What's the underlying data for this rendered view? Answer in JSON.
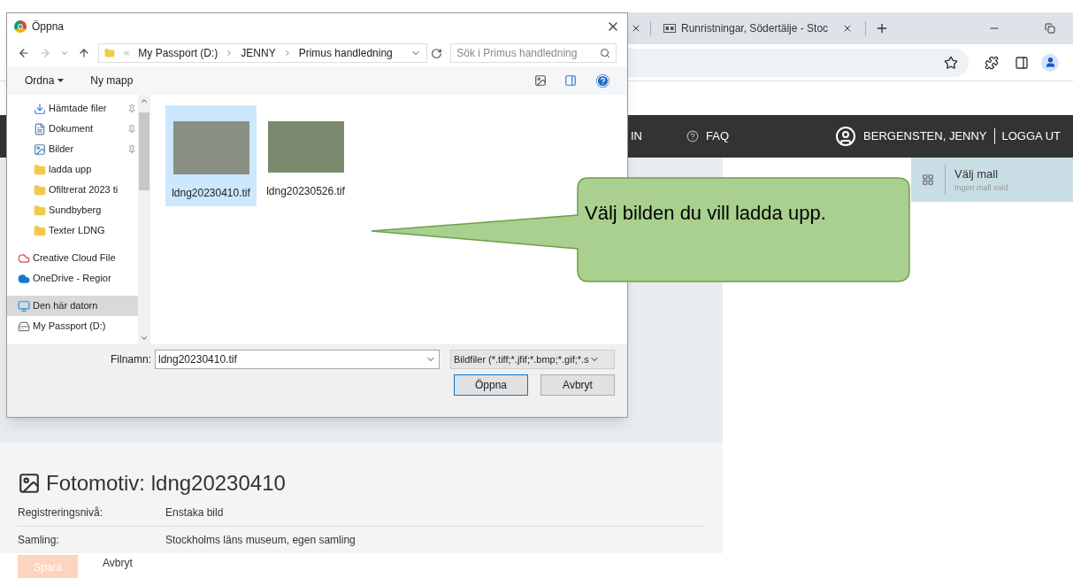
{
  "browser": {
    "tabs": [
      {
        "title": "Runristningar, Södertälje - Stoc",
        "selected": false
      }
    ]
  },
  "nav": {
    "items": [
      {
        "label": "IN"
      },
      {
        "label": "FAQ"
      }
    ],
    "user": "BERGENSTEN, JENNY",
    "logout": "LOGGA UT"
  },
  "template": {
    "title": "Välj mall",
    "subtitle": "Ingen mall vald"
  },
  "form": {
    "heading": "Fotomotiv: ldng20230410",
    "rows": [
      {
        "label": "Registreringsnivå:",
        "value": "Enstaka bild"
      },
      {
        "label": "Samling:",
        "value": "Stockholms läns museum, egen samling"
      }
    ],
    "save": "Spara",
    "cancel": "Avbryt"
  },
  "dialog": {
    "title": "Öppna",
    "path": [
      "My Passport (D:)",
      "JENNY",
      "Primus handledning"
    ],
    "search": {
      "placeholder": "Sök i Primus handledning"
    },
    "toolbar": [
      "Ordna",
      "Ny mapp"
    ],
    "sidebar": [
      {
        "label": "Hämtade filer",
        "kind": "download",
        "pinned": true,
        "selected": false
      },
      {
        "label": "Dokument",
        "kind": "document",
        "pinned": true,
        "selected": false
      },
      {
        "label": "Bilder",
        "kind": "pictures",
        "pinned": true,
        "selected": false
      },
      {
        "label": "ladda upp",
        "kind": "folder",
        "pinned": false,
        "selected": false
      },
      {
        "label": "Ofiltrerat 2023 ti",
        "kind": "folder",
        "pinned": false,
        "selected": false
      },
      {
        "label": "Sundbyberg",
        "kind": "folder",
        "pinned": false,
        "selected": false
      },
      {
        "label": "Texter LDNG",
        "kind": "folder",
        "pinned": false,
        "selected": false
      },
      {
        "label": "Creative Cloud File",
        "kind": "cloud",
        "pinned": false,
        "selected": false
      },
      {
        "label": "OneDrive - Regior",
        "kind": "onedrive",
        "pinned": false,
        "selected": false
      },
      {
        "label": "Den här datorn",
        "kind": "computer",
        "pinned": false,
        "selected": true
      },
      {
        "label": "My Passport (D:)",
        "kind": "drive",
        "pinned": false,
        "selected": false
      }
    ],
    "files": [
      {
        "name": "ldng20230410.tif",
        "selected": true
      },
      {
        "name": "ldng20230526.tif",
        "selected": false
      }
    ],
    "filename_label": "Filnamn:",
    "filename": "ldng20230410.tif",
    "filter": "Bildfiler (*.tiff;*.jfif;*.bmp;*.gif;*.s",
    "open": "Öppna",
    "cancel": "Avbryt"
  },
  "callout": {
    "text": "Välj bilden du vill ladda upp."
  }
}
